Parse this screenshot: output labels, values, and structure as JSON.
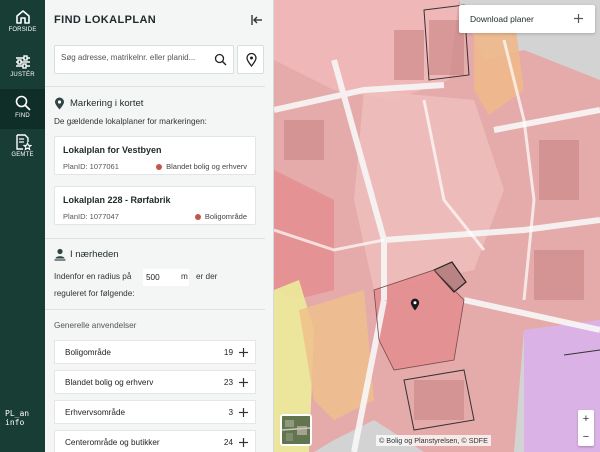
{
  "rail": {
    "items": [
      {
        "label": "FORSIDE",
        "icon": "home-icon"
      },
      {
        "label": "JUSTÉR",
        "icon": "sliders-icon"
      },
      {
        "label": "FIND",
        "icon": "search-icon"
      },
      {
        "label": "GEMTE",
        "icon": "saved-list-icon"
      }
    ],
    "logo_line1": "PL_an",
    "logo_line2": "info"
  },
  "panel": {
    "title": "FIND LOKALPLAN",
    "search_placeholder": "Søg adresse, matrikelnr. eller planid...",
    "marking": {
      "heading": "Markering i kortet",
      "hint": "De gældende lokalplaner for markeringen:",
      "cards": [
        {
          "title": "Lokalplan for Vestbyen",
          "plan_id": "PlanID: 1077061",
          "type": "Blandet bolig og erhverv"
        },
        {
          "title": "Lokalplan 228 - Rørfabrik",
          "plan_id": "PlanID: 1077047",
          "type": "Boligområde"
        }
      ]
    },
    "nearby": {
      "heading": "I nærheden",
      "text_before": "Indenfor en radius på",
      "radius_value": "500",
      "unit": "m",
      "text_after": "er der",
      "text_line2": "reguleret for følgende:"
    },
    "categories": {
      "heading": "Generelle anvendelser",
      "items": [
        {
          "label": "Boligområde",
          "count": "19"
        },
        {
          "label": "Blandet bolig og erhverv",
          "count": "23"
        },
        {
          "label": "Erhvervsområde",
          "count": "3"
        },
        {
          "label": "Centerområde og butikker",
          "count": "24"
        }
      ]
    }
  },
  "map": {
    "download_label": "Download planer",
    "attribution": "© Bolig og Planstyrelsen, © SDFE",
    "zoom_in": "+",
    "zoom_out": "−"
  },
  "colors": {
    "rail": "#173d35",
    "plan_red": "#e8a3a3",
    "plan_orange": "#efc08c",
    "plan_yellow": "#ecec9a",
    "plan_purple": "#d9a6e6",
    "dot": "#c0574a"
  }
}
